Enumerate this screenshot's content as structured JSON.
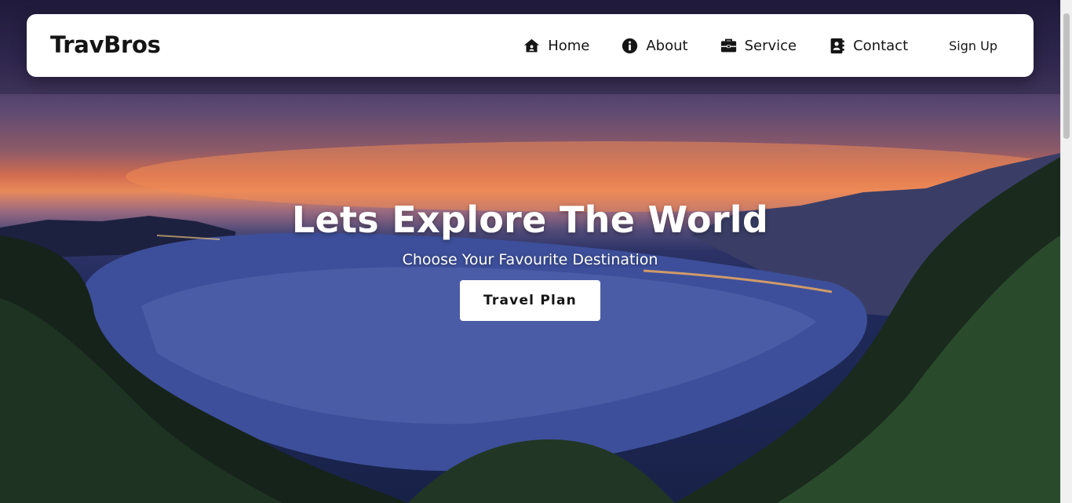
{
  "navbar": {
    "brand": "TravBros",
    "links": [
      {
        "label": "Home",
        "icon": "home-icon"
      },
      {
        "label": "About",
        "icon": "info-icon"
      },
      {
        "label": "Service",
        "icon": "briefcase-icon"
      },
      {
        "label": "Contact",
        "icon": "contact-book-icon"
      }
    ],
    "signup_label": "Sign Up"
  },
  "hero": {
    "title": "Lets Explore The World",
    "subtitle": "Choose Your Favourite Destination",
    "cta_label": "Travel Plan",
    "background_image": "coastal-bay-at-dusk"
  },
  "colors": {
    "navbar_bg": "#ffffff",
    "text_dark": "#151515",
    "hero_text": "#ffffff"
  }
}
